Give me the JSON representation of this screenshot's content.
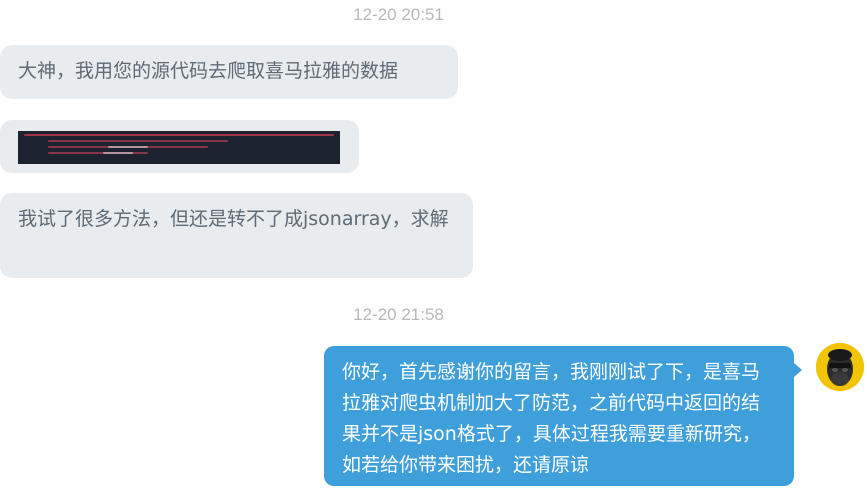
{
  "chat": {
    "timestamps": [
      "12-20 20:51",
      "12-20 21:58"
    ],
    "incoming": [
      {
        "text": "大神，我用您的源代码去爬取喜马拉雅的数据"
      },
      {
        "image": "code-error-screenshot"
      },
      {
        "text": "我试了很多方法，但还是转不了成jsonarray，求解"
      }
    ],
    "outgoing": [
      {
        "text": "你好，首先感谢你的留言，我刚刚试了下，是喜马拉雅对爬虫机制加大了防范，之前代码中返回的结果并不是json格式了，具体过程我需要重新研究，如若给你带来困扰，还请原谅"
      }
    ]
  },
  "colors": {
    "incoming_bubble": "#e8ecee",
    "outgoing_bubble": "#3f9fdb",
    "timestamp": "#b9b9b9",
    "avatar_bg": "#f2c400"
  }
}
